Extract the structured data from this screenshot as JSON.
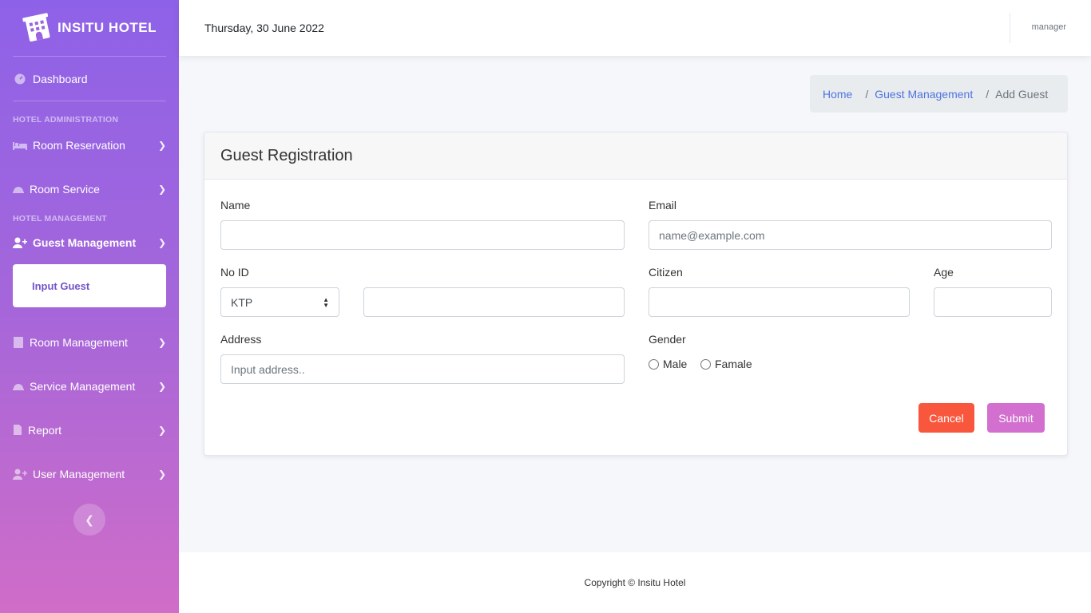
{
  "brand": {
    "name": "INSITU HOTEL",
    "logo_icon": "hotel-building-icon"
  },
  "sidebar": {
    "dashboard": {
      "label": "Dashboard",
      "icon": "gauge-icon"
    },
    "heading_admin": "HOTEL ADMINISTRATION",
    "room_reservation": {
      "label": "Room Reservation",
      "icon": "bed-icon"
    },
    "room_service": {
      "label": "Room Service",
      "icon": "bell-icon"
    },
    "heading_management": "HOTEL MANAGEMENT",
    "guest_management": {
      "label": "Guest Management",
      "icon": "user-plus-icon"
    },
    "input_guest": {
      "label": "Input Guest"
    },
    "room_management": {
      "label": "Room Management",
      "icon": "building-icon"
    },
    "service_management": {
      "label": "Service Management",
      "icon": "bell-icon"
    },
    "report": {
      "label": "Report",
      "icon": "file-icon"
    },
    "user_management": {
      "label": "User Management",
      "icon": "user-plus-icon"
    },
    "toggle_icon": "chevron-left-icon"
  },
  "topbar": {
    "date": "Thursday, 30 June 2022",
    "user": "manager"
  },
  "breadcrumb": {
    "home": "Home",
    "section": "Guest Management",
    "current": "Add Guest"
  },
  "form": {
    "title": "Guest Registration",
    "name_label": "Name",
    "email_label": "Email",
    "email_placeholder": "name@example.com",
    "noid_label": "No ID",
    "noid_type": "KTP",
    "citizen_label": "Citizen",
    "age_label": "Age",
    "address_label": "Address",
    "address_placeholder": "Input address..",
    "gender_label": "Gender",
    "gender_male": "Male",
    "gender_female": "Famale",
    "cancel": "Cancel",
    "submit": "Submit"
  },
  "footer": {
    "copyright": "Copyright © Insitu Hotel"
  }
}
